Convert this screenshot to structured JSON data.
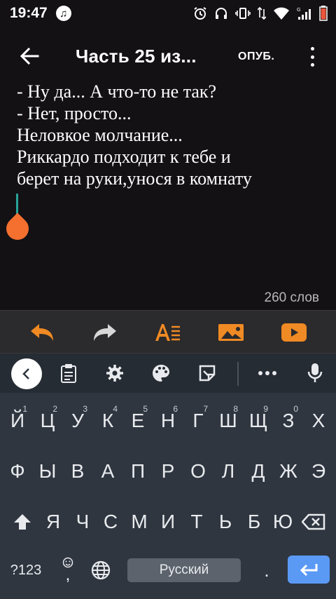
{
  "status_bar": {
    "time": "19:47",
    "music_glyph": "♫",
    "battery_color": "#e8553b"
  },
  "toolbar": {
    "title": "Часть 25 из...",
    "publish_label": "ОПУБ."
  },
  "editor": {
    "lines": [
      "- Ну да... А что-то не так?",
      "- Нет, просто...",
      "Неловкое молчание...",
      "Риккардо подходит к тебе  и",
      "берет на руки,унося в комнату"
    ],
    "word_count": "260 слов",
    "accent_color": "#f56f2f"
  },
  "format_bar": {
    "icons": [
      "undo-icon",
      "redo-icon",
      "text-format-icon",
      "image-icon",
      "video-icon"
    ]
  },
  "keyboard": {
    "row1": [
      {
        "k": "Й",
        "n": "1"
      },
      {
        "k": "Ц",
        "n": "2"
      },
      {
        "k": "У",
        "n": "3"
      },
      {
        "k": "К",
        "n": "4"
      },
      {
        "k": "Е",
        "n": "5"
      },
      {
        "k": "Н",
        "n": "6"
      },
      {
        "k": "Г",
        "n": "7"
      },
      {
        "k": "Ш",
        "n": "8"
      },
      {
        "k": "Щ",
        "n": "9"
      },
      {
        "k": "З",
        "n": "0"
      },
      {
        "k": "Х",
        "n": ""
      }
    ],
    "row2": [
      "Ф",
      "Ы",
      "В",
      "А",
      "П",
      "Р",
      "О",
      "Л",
      "Д",
      "Ж",
      "Э"
    ],
    "row3": [
      "Я",
      "Ч",
      "С",
      "М",
      "И",
      "Т",
      "Ь",
      "Б",
      "Ю"
    ],
    "symbols_label": "?123",
    "comma": ",",
    "period": ".",
    "space_label": "Русский",
    "enter_color": "#5a9af5"
  }
}
